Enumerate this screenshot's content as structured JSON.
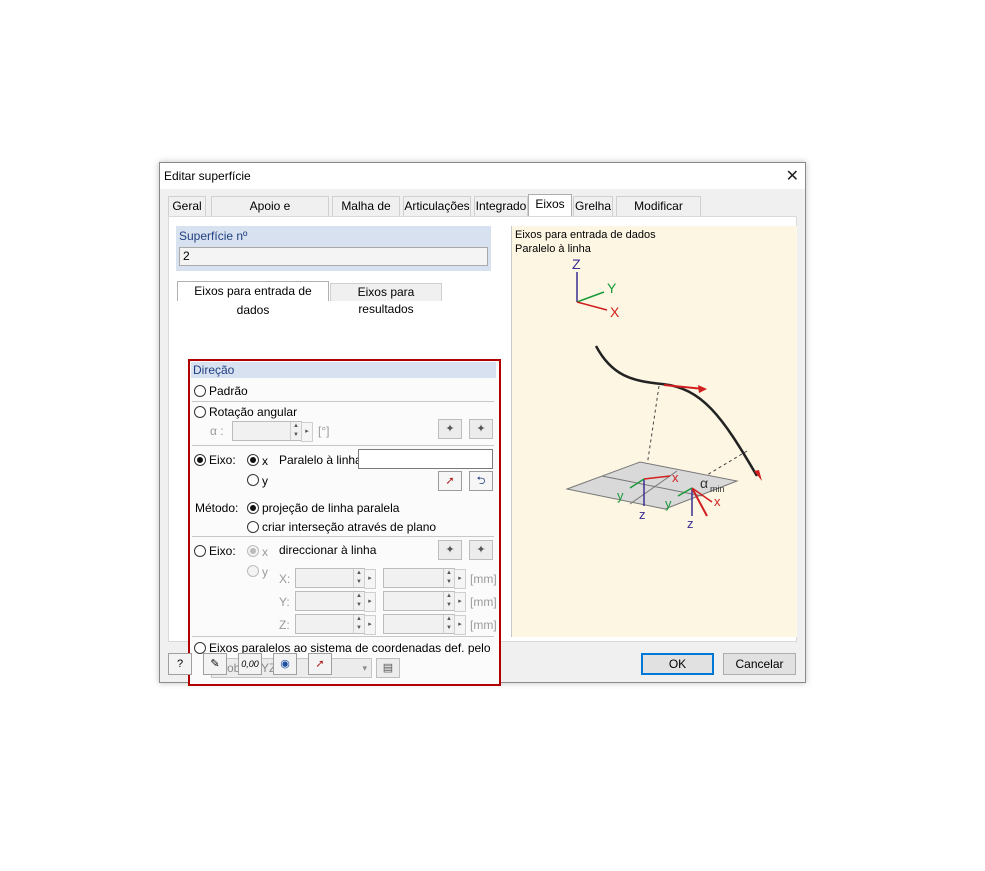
{
  "window": {
    "title": "Editar superfície",
    "close_glyph": "✕"
  },
  "tabs": [
    {
      "label": "Geral"
    },
    {
      "label": "Apoio e excentricidade"
    },
    {
      "label": "Malha de EF"
    },
    {
      "label": "Articulações"
    },
    {
      "label": "Integrado"
    },
    {
      "label": "Eixos",
      "active": true
    },
    {
      "label": "Grelha"
    },
    {
      "label": "Modificar rigidez"
    }
  ],
  "surface": {
    "label": "Superfície nº",
    "value": "2"
  },
  "subtabs": [
    {
      "label": "Eixos para entrada de dados",
      "active": true
    },
    {
      "label": "Eixos para resultados"
    }
  ],
  "direction": {
    "header": "Direção",
    "padrao": {
      "label": "Padrão",
      "selected": false
    },
    "rotacao": {
      "label": "Rotação angular",
      "selected": false,
      "alpha_label": "α :",
      "unit": "[°]",
      "value": ""
    },
    "eixo": {
      "label": "Eixo:",
      "selected": true,
      "x_label": "x",
      "y_label": "y",
      "x_selected": true,
      "paralelo_label": "Paralelo à linha:",
      "paralelo_value": ""
    },
    "metodo": {
      "label": "Método:",
      "option1": "projeção de linha paralela",
      "option2": "criar interseção através de plano",
      "selected": 1
    },
    "eixo2": {
      "label": "Eixo:",
      "selected": false,
      "x_label": "x",
      "y_label": "y",
      "direcionar_label": "direccionar à linha",
      "rows": [
        {
          "coord": "X:",
          "unit": "[mm]"
        },
        {
          "coord": "Y:",
          "unit": "[mm]"
        },
        {
          "coord": "Z:",
          "unit": "[mm]"
        }
      ]
    },
    "paralelos": {
      "label": "Eixos paralelos ao sistema de coordenadas def. pelo",
      "selected": false,
      "combo_value": "Global XYZ"
    }
  },
  "preview": {
    "line1": "Eixos para entrada de dados",
    "line2": "Paralelo à linha",
    "global_axes": {
      "z": "Z",
      "y": "Y",
      "x": "X"
    },
    "local_labels": {
      "x": "x",
      "y": "y",
      "z": "z",
      "alpha": "α",
      "alpha_sub": "min"
    }
  },
  "footer": {
    "ok": "OK",
    "cancel": "Cancelar",
    "units_label": "0,00"
  },
  "colors": {
    "accent": "#0078d7",
    "highlight_border": "#b00000",
    "section_header": "#d7e1f0",
    "preview_bg": "#fdf6e3"
  }
}
